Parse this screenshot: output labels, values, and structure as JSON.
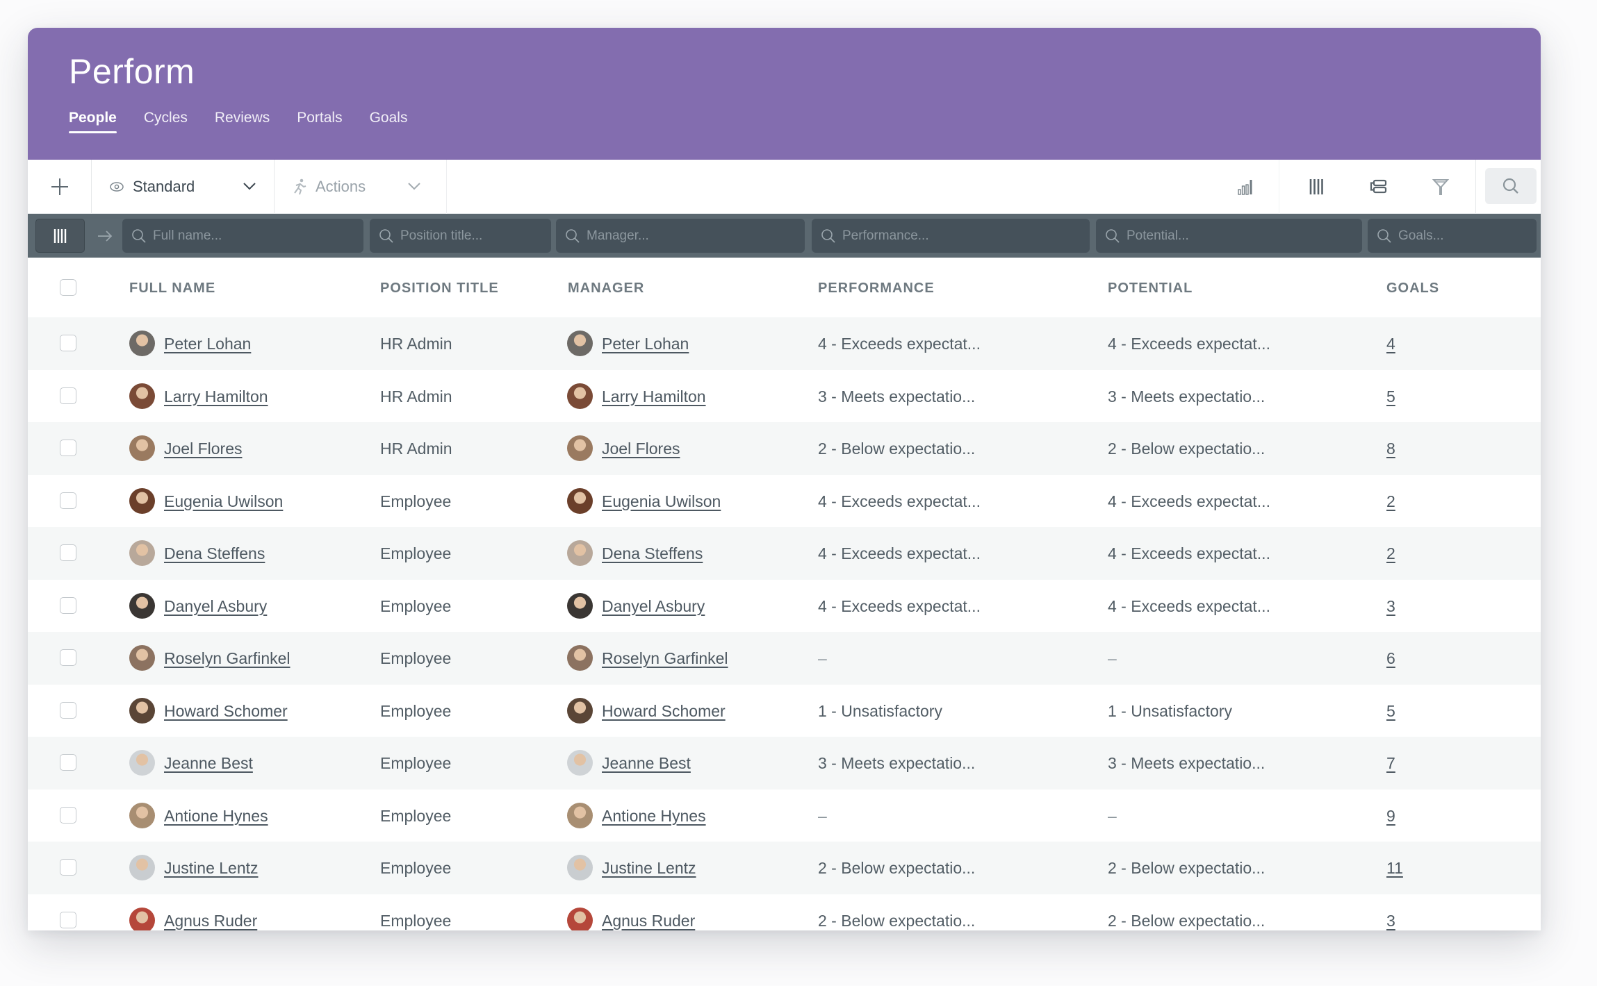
{
  "app": {
    "title": "Perform"
  },
  "tabs": [
    {
      "label": "People",
      "active": true
    },
    {
      "label": "Cycles",
      "active": false
    },
    {
      "label": "Reviews",
      "active": false
    },
    {
      "label": "Portals",
      "active": false
    },
    {
      "label": "Goals",
      "active": false
    }
  ],
  "toolbar": {
    "add_icon": "plus-icon",
    "view_label": "Standard",
    "view_icon": "eye-icon",
    "actions_label": "Actions",
    "actions_icon": "running-person-icon",
    "right_icons": [
      "bar-chart-icon",
      "columns-icon",
      "group-icon",
      "filter-icon",
      "search-icon"
    ]
  },
  "filters": {
    "full_name": "Full name...",
    "position_title": "Position title...",
    "manager": "Manager...",
    "performance": "Performance...",
    "potential": "Potential...",
    "goals": "Goals..."
  },
  "columns": {
    "full_name": "FULL NAME",
    "position_title": "POSITION TITLE",
    "manager": "MANAGER",
    "performance": "PERFORMANCE",
    "potential": "POTENTIAL",
    "goals": "GOALS"
  },
  "rows": [
    {
      "name": "Peter Lohan",
      "position": "HR Admin",
      "manager": "Peter Lohan",
      "performance": "4 - Exceeds expectat...",
      "potential": "4 - Exceeds expectat...",
      "goals": "4",
      "avatar_color": "#6d6a66"
    },
    {
      "name": "Larry Hamilton",
      "position": "HR Admin",
      "manager": "Larry Hamilton",
      "performance": "3 - Meets expectatio...",
      "potential": "3 - Meets expectatio...",
      "goals": "5",
      "avatar_color": "#7a4a36"
    },
    {
      "name": "Joel Flores",
      "position": "HR Admin",
      "manager": "Joel Flores",
      "performance": "2 - Below expectatio...",
      "potential": "2 - Below expectatio...",
      "goals": "8",
      "avatar_color": "#9a7a60"
    },
    {
      "name": "Eugenia Uwilson",
      "position": "Employee",
      "manager": "Eugenia Uwilson",
      "performance": "4 - Exceeds expectat...",
      "potential": "4 - Exceeds expectat...",
      "goals": "2",
      "avatar_color": "#6b3f2a"
    },
    {
      "name": "Dena Steffens",
      "position": "Employee",
      "manager": "Dena Steffens",
      "performance": "4 - Exceeds expectat...",
      "potential": "4 - Exceeds expectat...",
      "goals": "2",
      "avatar_color": "#b8a89a"
    },
    {
      "name": "Danyel Asbury",
      "position": "Employee",
      "manager": "Danyel Asbury",
      "performance": "4 - Exceeds expectat...",
      "potential": "4 - Exceeds expectat...",
      "goals": "3",
      "avatar_color": "#3a3633"
    },
    {
      "name": "Roselyn Garfinkel",
      "position": "Employee",
      "manager": "Roselyn Garfinkel",
      "performance": "–",
      "potential": "–",
      "goals": "6",
      "avatar_color": "#8c7260"
    },
    {
      "name": "Howard Schomer",
      "position": "Employee",
      "manager": "Howard Schomer",
      "performance": "1 - Unsatisfactory",
      "potential": "1 - Unsatisfactory",
      "goals": "5",
      "avatar_color": "#5a4536"
    },
    {
      "name": "Jeanne Best",
      "position": "Employee",
      "manager": "Jeanne Best",
      "performance": "3 - Meets expectatio...",
      "potential": "3 - Meets expectatio...",
      "goals": "7",
      "avatar_color": "#cfd3d6"
    },
    {
      "name": "Antione Hynes",
      "position": "Employee",
      "manager": "Antione Hynes",
      "performance": "–",
      "potential": "–",
      "goals": "9",
      "avatar_color": "#a88e72"
    },
    {
      "name": "Justine Lentz",
      "position": "Employee",
      "manager": "Justine Lentz",
      "performance": "2 - Below expectatio...",
      "potential": "2 - Below expectatio...",
      "goals": "11",
      "avatar_color": "#c9cdd0"
    },
    {
      "name": "Agnus Ruder",
      "position": "Employee",
      "manager": "Agnus Ruder",
      "performance": "2 - Below expectatio...",
      "potential": "2 - Below expectatio...",
      "goals": "3",
      "avatar_color": "#b5473a"
    }
  ],
  "colors": {
    "brand": "#836daf",
    "filter_bar": "#5b6870",
    "filter_input": "#45515a"
  }
}
